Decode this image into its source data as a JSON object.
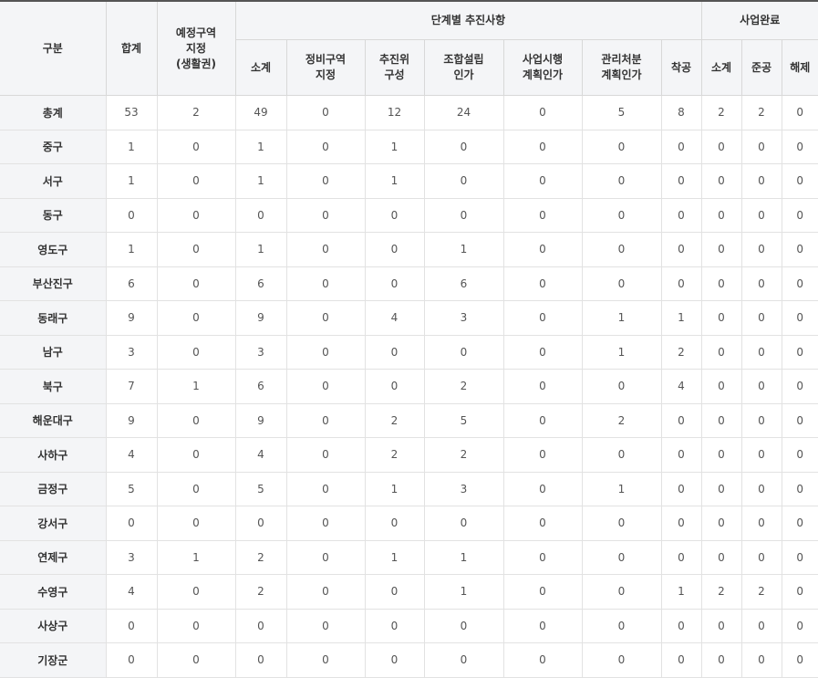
{
  "headers": {
    "category": "구분",
    "total": "합계",
    "designated": "예정구역\n지정\n(생활권)",
    "stages_group": "단계별 추진사항",
    "completed_group": "사업완료",
    "stages": [
      "소계",
      "정비구역\n지정",
      "추진위\n구성",
      "조합설립\n인가",
      "사업시행\n계획인가",
      "관리처분\n계획인가",
      "착공"
    ],
    "completed": [
      "소계",
      "준공",
      "해제"
    ]
  },
  "rows": [
    {
      "name": "총계",
      "values": [
        "53",
        "2",
        "49",
        "0",
        "12",
        "24",
        "0",
        "5",
        "8",
        "2",
        "2",
        "0"
      ]
    },
    {
      "name": "중구",
      "values": [
        "1",
        "0",
        "1",
        "0",
        "1",
        "0",
        "0",
        "0",
        "0",
        "0",
        "0",
        "0"
      ]
    },
    {
      "name": "서구",
      "values": [
        "1",
        "0",
        "1",
        "0",
        "1",
        "0",
        "0",
        "0",
        "0",
        "0",
        "0",
        "0"
      ]
    },
    {
      "name": "동구",
      "values": [
        "0",
        "0",
        "0",
        "0",
        "0",
        "0",
        "0",
        "0",
        "0",
        "0",
        "0",
        "0"
      ]
    },
    {
      "name": "영도구",
      "values": [
        "1",
        "0",
        "1",
        "0",
        "0",
        "1",
        "0",
        "0",
        "0",
        "0",
        "0",
        "0"
      ]
    },
    {
      "name": "부산진구",
      "values": [
        "6",
        "0",
        "6",
        "0",
        "0",
        "6",
        "0",
        "0",
        "0",
        "0",
        "0",
        "0"
      ]
    },
    {
      "name": "동래구",
      "values": [
        "9",
        "0",
        "9",
        "0",
        "4",
        "3",
        "0",
        "1",
        "1",
        "0",
        "0",
        "0"
      ]
    },
    {
      "name": "남구",
      "values": [
        "3",
        "0",
        "3",
        "0",
        "0",
        "0",
        "0",
        "1",
        "2",
        "0",
        "0",
        "0"
      ]
    },
    {
      "name": "북구",
      "values": [
        "7",
        "1",
        "6",
        "0",
        "0",
        "2",
        "0",
        "0",
        "4",
        "0",
        "0",
        "0"
      ]
    },
    {
      "name": "해운대구",
      "values": [
        "9",
        "0",
        "9",
        "0",
        "2",
        "5",
        "0",
        "2",
        "0",
        "0",
        "0",
        "0"
      ]
    },
    {
      "name": "사하구",
      "values": [
        "4",
        "0",
        "4",
        "0",
        "2",
        "2",
        "0",
        "0",
        "0",
        "0",
        "0",
        "0"
      ]
    },
    {
      "name": "금정구",
      "values": [
        "5",
        "0",
        "5",
        "0",
        "1",
        "3",
        "0",
        "1",
        "0",
        "0",
        "0",
        "0"
      ]
    },
    {
      "name": "강서구",
      "values": [
        "0",
        "0",
        "0",
        "0",
        "0",
        "0",
        "0",
        "0",
        "0",
        "0",
        "0",
        "0"
      ]
    },
    {
      "name": "연제구",
      "values": [
        "3",
        "1",
        "2",
        "0",
        "1",
        "1",
        "0",
        "0",
        "0",
        "0",
        "0",
        "0"
      ]
    },
    {
      "name": "수영구",
      "values": [
        "4",
        "0",
        "2",
        "0",
        "0",
        "1",
        "0",
        "0",
        "1",
        "2",
        "2",
        "0"
      ]
    },
    {
      "name": "사상구",
      "values": [
        "0",
        "0",
        "0",
        "0",
        "0",
        "0",
        "0",
        "0",
        "0",
        "0",
        "0",
        "0"
      ]
    },
    {
      "name": "기장군",
      "values": [
        "0",
        "0",
        "0",
        "0",
        "0",
        "0",
        "0",
        "0",
        "0",
        "0",
        "0",
        "0"
      ]
    }
  ]
}
